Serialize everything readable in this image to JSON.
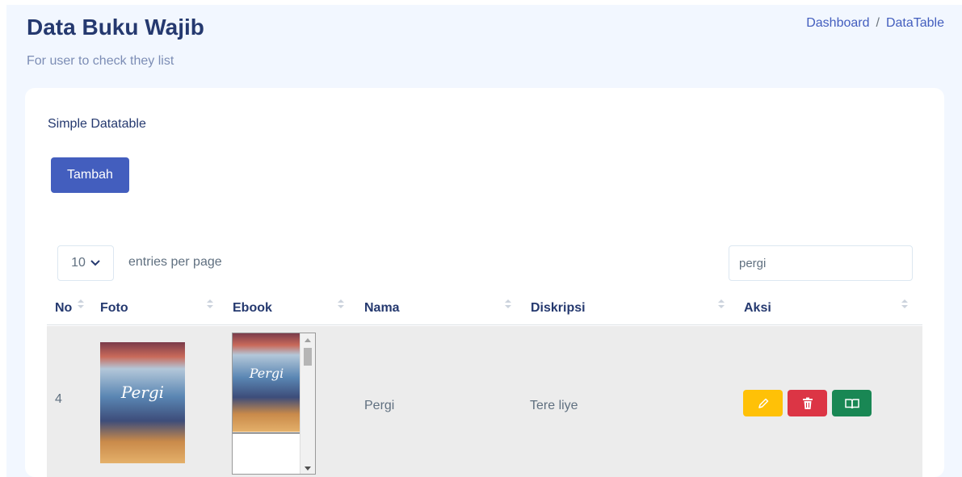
{
  "header": {
    "title": "Data Buku Wajib",
    "subtitle": "For user to check they list",
    "breadcrumb": [
      "Dashboard",
      "DataTable"
    ],
    "breadcrumb_separator": "/"
  },
  "card": {
    "title": "Simple Datatable",
    "add_button_label": "Tambah"
  },
  "datatable": {
    "per_page_value": "10",
    "per_page_label": "entries per page",
    "search_value": "pergi",
    "columns": [
      "No",
      "Foto",
      "Ebook",
      "Nama",
      "Diskripsi",
      "Aksi"
    ],
    "rows": [
      {
        "no": "4",
        "foto_title": "Pergi",
        "ebook_title": "Pergi",
        "nama": "Pergi",
        "diskripsi": "Tere liye",
        "actions": [
          "edit-icon",
          "trash-icon",
          "book-open-icon"
        ]
      }
    ]
  },
  "colors": {
    "primary": "#435ebe",
    "edit": "#ffc107",
    "delete": "#dc3545",
    "read": "#198754",
    "page_background": "#f2f7ff"
  }
}
